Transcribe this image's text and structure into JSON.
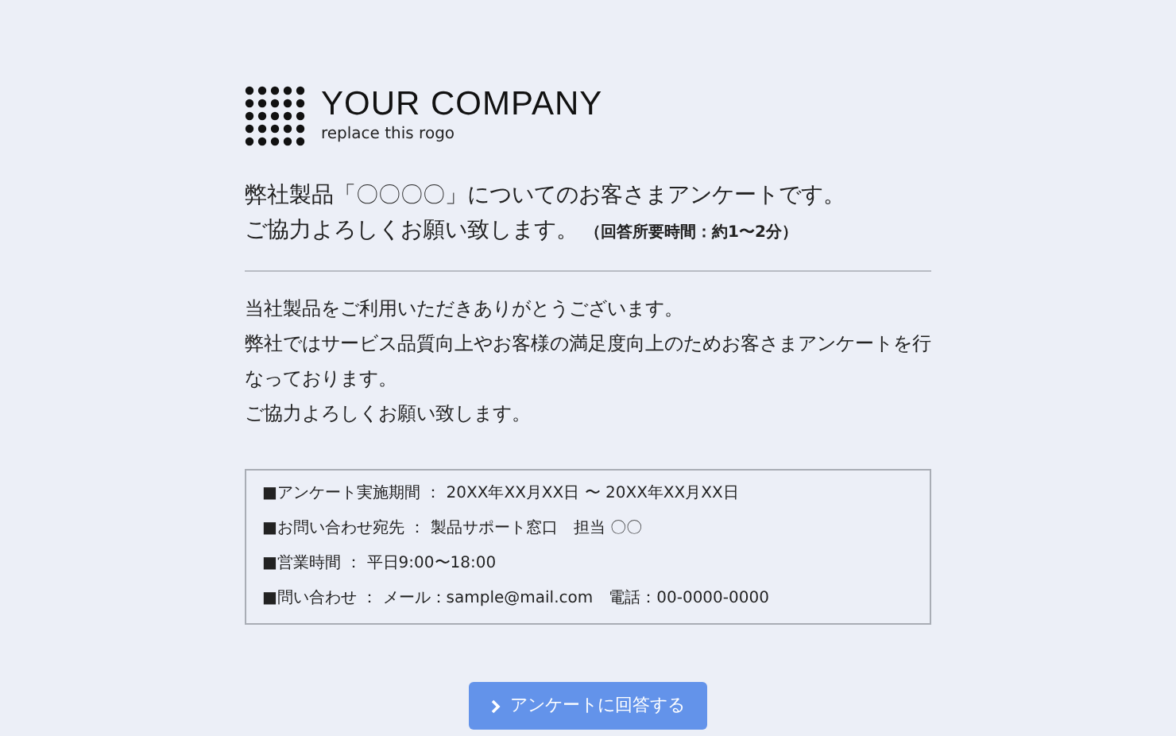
{
  "logo": {
    "name": "YOUR COMPANY",
    "tagline": "replace this rogo"
  },
  "heading": {
    "lines": [
      "弊社製品「〇〇〇〇」についてのお客さまアンケートです。",
      "ご協力よろしくお願い致します。"
    ],
    "note": "（回答所要時間：約1〜2分）"
  },
  "intro": [
    "当社製品をご利用いただきありがとうございます。",
    "弊社ではサービス品質向上やお客様の満足度向上のためお客さまアンケートを行なっております。",
    "ご協力よろしくお願い致します。"
  ],
  "info": [
    "■アンケート実施期間 ： 20XX年XX月XX日 〜 20XX年XX月XX日",
    "■お問い合わせ宛先 ： 製品サポート窓口　担当 〇〇",
    "■営業時間 ： 平日9:00〜18:00",
    "■問い合わせ ： メール：sample@mail.com　電話：00-0000-0000"
  ],
  "button": {
    "label": "アンケートに回答する"
  }
}
